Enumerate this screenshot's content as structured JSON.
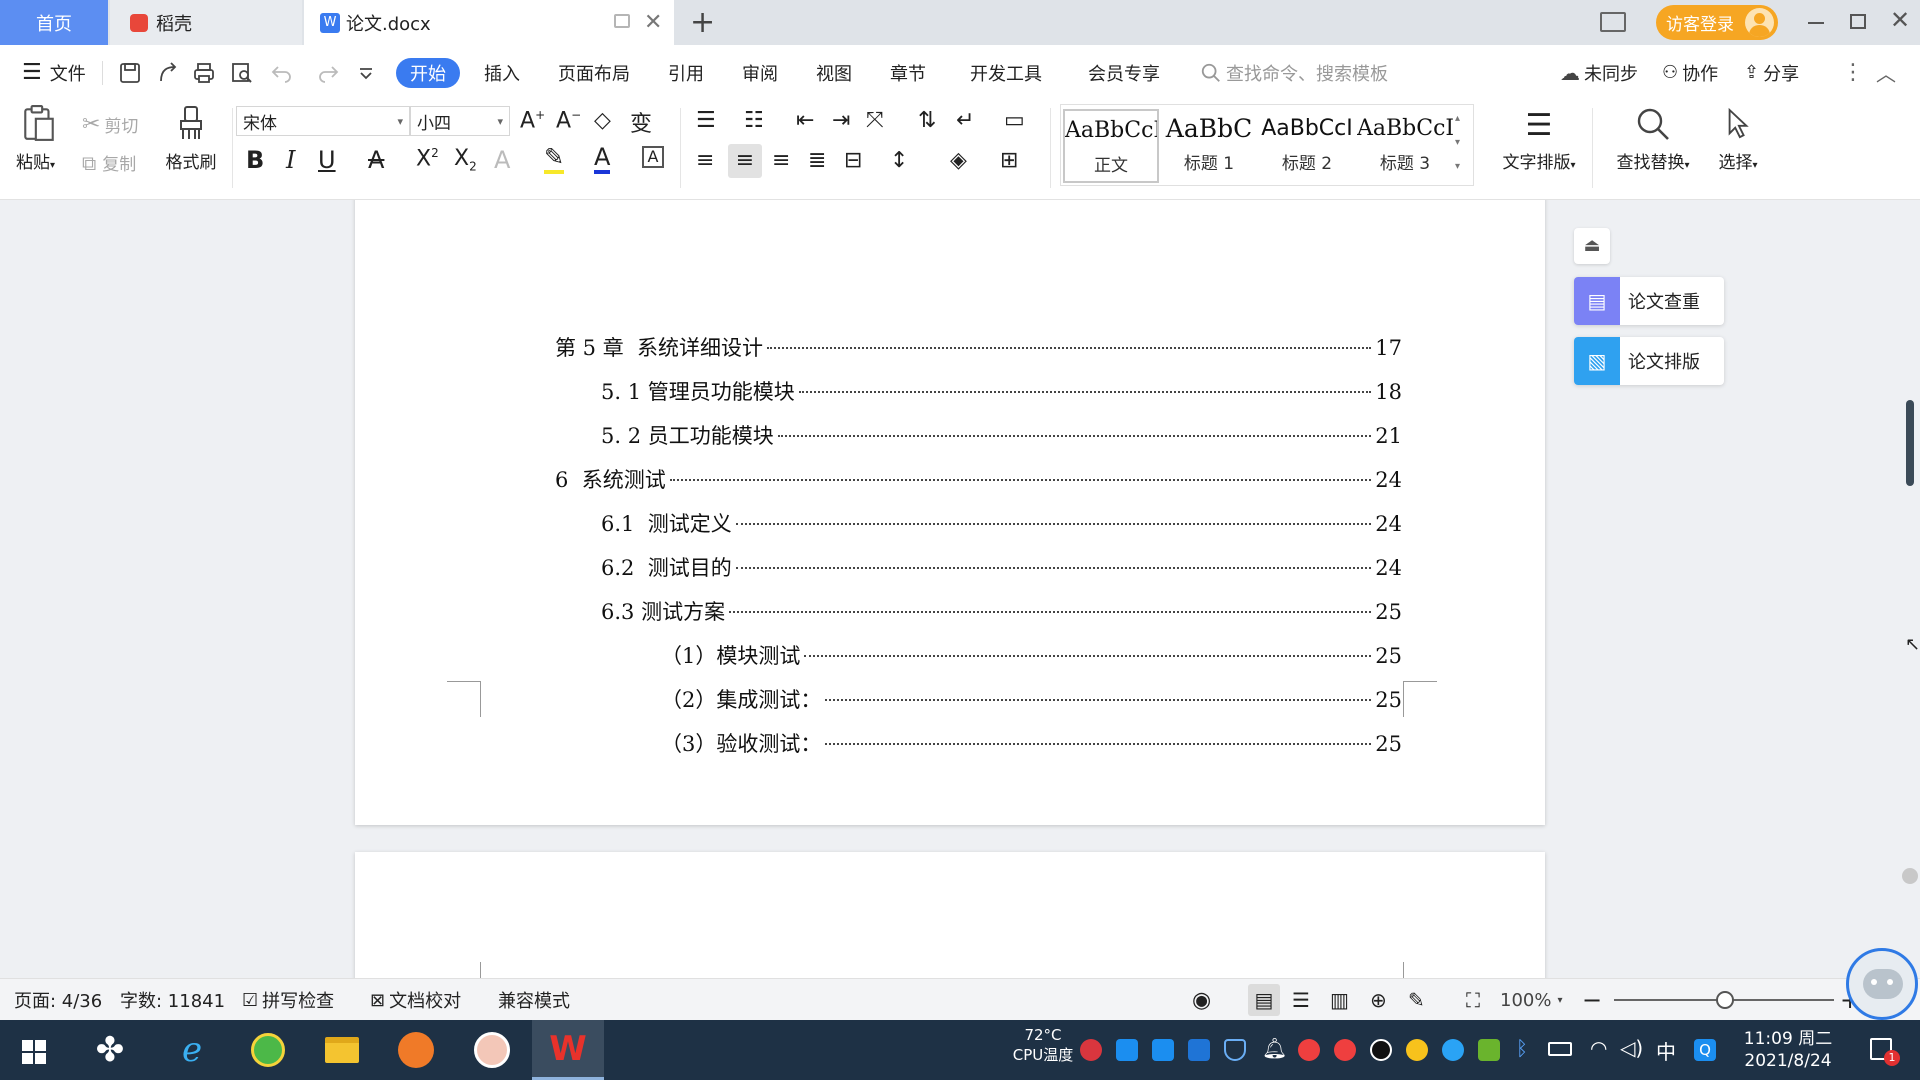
{
  "tabs": {
    "home": "首页",
    "daoke": "稻壳",
    "doc": "论文.docx",
    "login": "访客登录"
  },
  "menu": {
    "file": "文件",
    "items": [
      "开始",
      "插入",
      "页面布局",
      "引用",
      "审阅",
      "视图",
      "章节",
      "开发工具",
      "会员专享"
    ],
    "search_placeholder": "查找命令、搜索模板",
    "sync": "未同步",
    "collab": "协作",
    "share": "分享"
  },
  "ribbon": {
    "paste": "粘贴",
    "cut": "剪切",
    "copy": "复制",
    "format_painter": "格式刷",
    "font_name": "宋体",
    "font_size": "小四",
    "styles": [
      {
        "sample": "AaBbCcI",
        "name": "正文"
      },
      {
        "sample": "AaBbC",
        "name": "标题 1"
      },
      {
        "sample": "AaBbCcI",
        "name": "标题 2"
      },
      {
        "sample": "AaBbCcI",
        "name": "标题 3"
      }
    ],
    "text_layout": "文字排版",
    "find_replace": "查找替换",
    "select": "选择"
  },
  "toc": [
    {
      "text": "第 5 章  系统详细设计",
      "page": "17"
    },
    {
      "text": "5. 1 管理员功能模块",
      "page": "18"
    },
    {
      "text": "5. 2 员工功能模块",
      "page": "21"
    },
    {
      "text": "6  系统测试",
      "page": "24"
    },
    {
      "text": "6.1  测试定义",
      "page": "24"
    },
    {
      "text": "6.2  测试目的",
      "page": "24"
    },
    {
      "text": "6.3 测试方案",
      "page": "25"
    },
    {
      "text": "（1）模块测试",
      "page": "25"
    },
    {
      "text": "（2）集成测试：",
      "page": "25"
    },
    {
      "text": "（3）验收测试：",
      "page": "25"
    }
  ],
  "side_panel": {
    "check": "论文查重",
    "layout": "论文排版"
  },
  "status": {
    "page": "页面: 4/36",
    "words": "字数: 11841",
    "spell": "拼写检查",
    "proof": "文档校对",
    "compat": "兼容模式",
    "zoom": "100%"
  },
  "taskbar": {
    "temp": "72°C",
    "temp_label": "CPU温度",
    "ime": "中",
    "time": "11:09 周二",
    "date": "2021/8/24",
    "notif_count": "1"
  },
  "colors": {
    "accent": "#3a7bf0",
    "home_tab": "#5c8ef2",
    "login": "#f6a623",
    "taskbar": "#1e3145"
  }
}
